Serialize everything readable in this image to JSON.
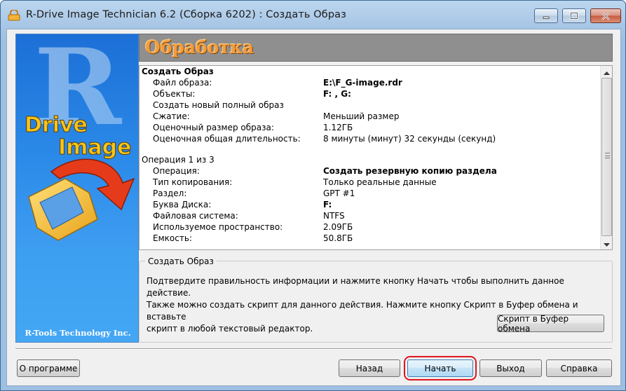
{
  "window": {
    "title": "R-Drive Image Technician 6.2 (Сборка 6202) : Создать Образ",
    "controls": [
      "minimize-icon",
      "maximize-icon",
      "close-icon"
    ]
  },
  "banner": {
    "logo_letter": "R",
    "logo_word1": "Drive",
    "logo_word2": "Image",
    "company": "R-Tools Technology Inc."
  },
  "header": {
    "title": "Обработка"
  },
  "summary": {
    "section1": {
      "title": "Создать Образ",
      "rows": [
        {
          "key": "Файл образа:",
          "value": "E:\\F_G-image.rdr",
          "bold": true
        },
        {
          "key": "Объекты:",
          "value": "F: , G:",
          "bold": true
        },
        {
          "key": "Создать новый полный образ",
          "value": "",
          "bold": false
        },
        {
          "key": "Сжатие:",
          "value": "Меньший размер",
          "bold": false
        },
        {
          "key": "Оценочный размер образа:",
          "value": "1.12ГБ",
          "bold": false
        },
        {
          "key": "Оценочная общая длительность:",
          "value": "8 минуты (минут) 32 секунды (секунд)",
          "bold": false
        }
      ]
    },
    "section2": {
      "title": "Операция 1 из 3",
      "rows": [
        {
          "key": "Операция:",
          "value": "Создать резервную копию раздела",
          "bold": true
        },
        {
          "key": "Тип копирования:",
          "value": "Только реальные данные",
          "bold": false
        },
        {
          "key": "Раздел:",
          "value": "GPT #1",
          "bold": false
        },
        {
          "key": "Буква Диска:",
          "value": "F:",
          "bold": true
        },
        {
          "key": "Файловая система:",
          "value": "NTFS",
          "bold": false
        },
        {
          "key": "Используемое пространство:",
          "value": "2.09ГБ",
          "bold": false
        },
        {
          "key": "Емкость:",
          "value": "50.8ГБ",
          "bold": false
        }
      ]
    }
  },
  "group": {
    "legend": "Создать Образ",
    "line1": "Подтвердите правильность информации и нажмите кнопку Начать чтобы выполнить данное действие.",
    "line2": "Также можно создать скрипт для данного действия. Нажмите кнопку Скрипт в Буфер обмена и вставьте",
    "line3": "скрипт в любой текстовый редактор.",
    "script_button": "Скрипт в Буфер обмена"
  },
  "buttons": {
    "about": "О программе",
    "back": "Назад",
    "start": "Начать",
    "exit": "Выход",
    "help": "Справка"
  },
  "colors": {
    "header_text": "#f39c3c",
    "highlight": "#e0141c",
    "banner_blue": "#2b8ae8"
  }
}
